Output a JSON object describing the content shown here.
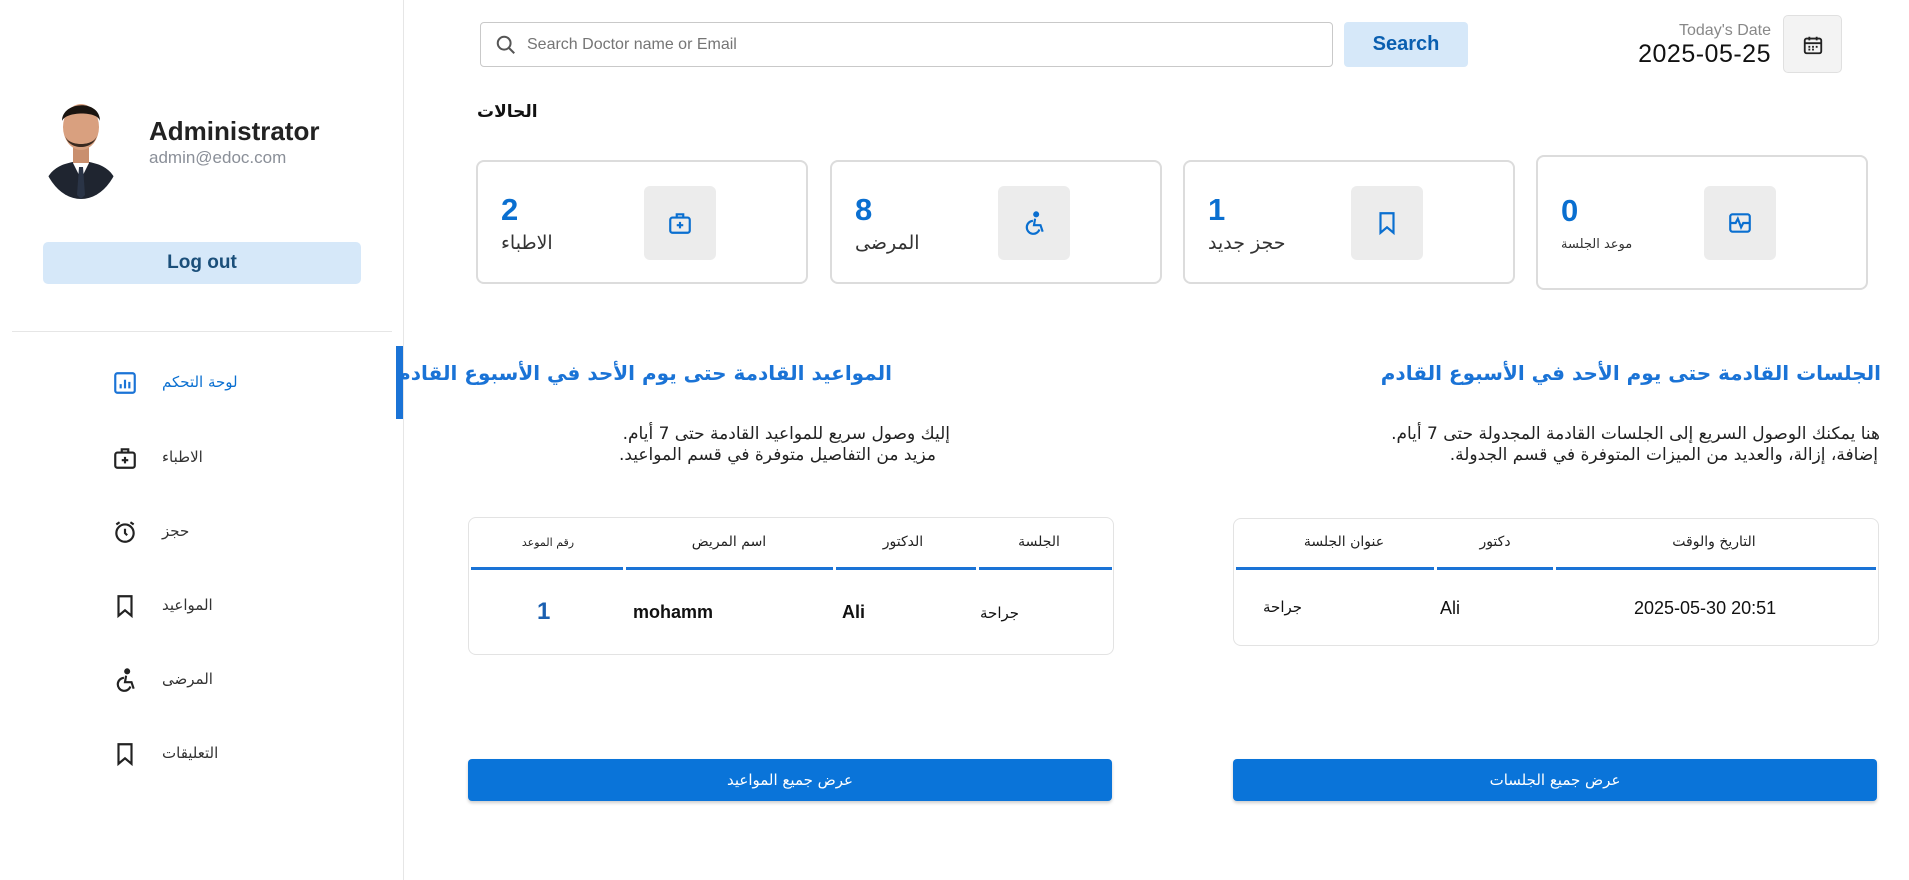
{
  "sidebar": {
    "admin_name": "Administrator",
    "admin_email": "admin@edoc.com",
    "logout_label": "Log out",
    "items": [
      {
        "label": "لوحة التحكم",
        "icon": "dashboard-icon",
        "active": true
      },
      {
        "label": "الاطباء",
        "icon": "medical-bag-icon",
        "active": false
      },
      {
        "label": "حجز",
        "icon": "alarm-clock-icon",
        "active": false
      },
      {
        "label": "المواعيد",
        "icon": "bookmark-icon",
        "active": false
      },
      {
        "label": "المرضى",
        "icon": "accessible-icon",
        "active": false
      },
      {
        "label": "التعليقات",
        "icon": "bookmark-icon",
        "active": false
      }
    ]
  },
  "header": {
    "search_placeholder": "Search Doctor name or Email",
    "search_button": "Search",
    "date_caption": "Today's Date",
    "date_value": "2025-05-25"
  },
  "status": {
    "title": "الحالات",
    "cards": [
      {
        "value": "2",
        "label": "الاطباء",
        "icon": "medical-bag-icon"
      },
      {
        "value": "8",
        "label": "المرضى",
        "icon": "accessible-icon"
      },
      {
        "value": "1",
        "label": "حجز جديد",
        "icon": "bookmark-icon"
      },
      {
        "value": "0",
        "label": "موعد الجلسة",
        "icon": "pulse-icon"
      }
    ]
  },
  "appointments": {
    "heading": "المواعيد القادمة حتى يوم الأحد في الأسبوع القادم",
    "desc_line1": "إليك وصول سريع للمواعيد القادمة حتى 7 أيام.",
    "desc_line2": "مزيد من التفاصيل متوفرة في قسم المواعيد.",
    "columns": [
      "رقم الموعد",
      "اسم المريض",
      "الدكتور",
      "الجلسة"
    ],
    "rows": [
      {
        "number": "1",
        "patient": "mohamm",
        "doctor": "Ali",
        "session": "جراحة"
      }
    ],
    "button": "عرض جميع المواعيد"
  },
  "sessions": {
    "heading": "الجلسات القادمة حتى يوم الأحد في الأسبوع القادم",
    "desc_line1": "هنا يمكنك الوصول السريع إلى الجلسات القادمة المجدولة حتى 7 أيام.",
    "desc_line2": "إضافة، إزالة، والعديد من الميزات المتوفرة في قسم الجدولة.",
    "columns": [
      "عنوان الجلسة",
      "دكتور",
      "التاريخ والوقت"
    ],
    "rows": [
      {
        "title": "جراحة",
        "doctor": "Ali",
        "datetime": "2025-05-30 20:51"
      }
    ],
    "button": "عرض جميع الجلسات"
  },
  "colors": {
    "accent": "#1a73d6",
    "button_blue": "#0a74d9",
    "light_blue": "#d6e8f9"
  }
}
